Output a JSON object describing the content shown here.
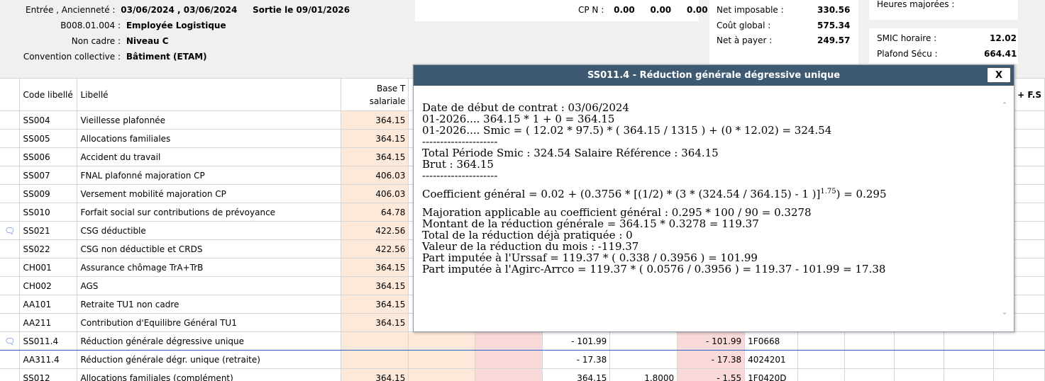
{
  "header": {
    "entry_label": "Entrée , Ancienneté :",
    "entry_value": "03/06/2024 , 03/06/2024",
    "exit_value": "Sortie le 09/01/2026",
    "job_code": "B008.01.004 :",
    "job_value": "Employée Logistique",
    "status_label": "Non cadre :",
    "status_value": "Niveau C",
    "convention_label": "Convention collective :",
    "convention_value": "Bâtiment (ETAM)",
    "cpn_label": "CP N :",
    "cpn_values": [
      "0.00",
      "0.00",
      "0.00"
    ],
    "net_imposable_label": "Net imposable :",
    "net_imposable": "330.56",
    "cout_global_label": "Coût global :",
    "cout_global": "575.34",
    "net_payer_label": "Net à payer :",
    "net_payer": "249.57",
    "heures_label": "Heures majorées :",
    "smic_label": "SMIC horaire :",
    "smic": "12.02",
    "plafond_label": "Plafond Sécu :",
    "plafond": "664.41"
  },
  "table": {
    "col_code": "Code libellé",
    "col_libelle": "Libellé",
    "col_base": "Base T salariale",
    "col_right": "+ F.S",
    "rows": [
      {
        "code": "SS004",
        "label": "Vieillesse plafonnée",
        "base": "364.15"
      },
      {
        "code": "SS005",
        "label": "Allocations familiales",
        "base": "364.15"
      },
      {
        "code": "SS006",
        "label": "Accident du travail",
        "base": "364.15"
      },
      {
        "code": "SS007",
        "label": "FNAL plafonné majoration CP",
        "base": "406.03"
      },
      {
        "code": "SS009",
        "label": "Versement mobilité majoration CP",
        "base": "406.03"
      },
      {
        "code": "SS010",
        "label": "Forfait social sur contributions de prévoyance",
        "base": "64.78"
      },
      {
        "code": "SS021",
        "label": "CSG déductible",
        "base": "422.56"
      },
      {
        "code": "SS022",
        "label": "CSG non déductible et CRDS",
        "base": "422.56"
      },
      {
        "code": "CH001",
        "label": "Assurance chômage TrA+TrB",
        "base": "364.15"
      },
      {
        "code": "CH002",
        "label": "AGS",
        "base": "364.15"
      },
      {
        "code": "AA101",
        "label": "Retraite TU1 non cadre",
        "base": "364.15"
      },
      {
        "code": "AA211",
        "label": "Contribution d'Equilibre Général TU1",
        "base": "364.15"
      }
    ],
    "row_ss011": {
      "code": "SS011.4",
      "label": "Réduction générale dégressive unique",
      "v1": "- 101.99",
      "v2": "- 101.99",
      "acct": "1F0668"
    },
    "row_aa311": {
      "code": "AA311.4",
      "label": "Réduction générale dégr. unique (retraite)",
      "v1": "- 17.38",
      "v2": "- 17.38",
      "acct": "4024201"
    },
    "row_partial": {
      "code": "SS012",
      "label": "Allocations familiales (complément)",
      "base": "364.15",
      "v1": "364.15",
      "v2": "1.8000",
      "v3": "- 1.55",
      "acct": "1F0420D"
    }
  },
  "popup": {
    "title": "SS011.4 - Réduction générale dégressive unique",
    "close_label": "X",
    "line1": "Date de début de contrat : 03/06/2024",
    "line2": "01-2026.... 364.15 * 1 + 0 = 364.15",
    "line3": "01-2026.... Smic = ( 12.02 * 97.5) * ( 364.15 / 1315 ) + (0 * 12.02) = 324.54",
    "sep1": "---------------------",
    "line4": "Total Période Smic : 324.54 Salaire Référence : 364.15",
    "line5": "Brut : 364.15",
    "sep2": "---------------------",
    "coef_pre": "Coefficient général = 0.02 + (0.3756 * [(1/2) * (3 * (324.54 / 364.15) - 1 )]",
    "coef_exp": "1.75",
    "coef_post": ") = 0.295",
    "line6": "Majoration applicable au coefficient général : 0.295 * 100 / 90 = 0.3278",
    "line7": "Montant de la réduction générale = 364.15 * 0.3278 = 119.37",
    "line8": "Total de la réduction déjà pratiquée : 0",
    "line9": "Valeur de la réduction du mois : -119.37",
    "line10": "Part imputée à l'Urssaf = 119.37 * ( 0.338 / 0.3956 ) = 101.99",
    "line11": "Part imputée à l'Agirc-Arrco = 119.37 * ( 0.0576 / 0.3956 ) = 119.37 - 101.99 = 17.38"
  }
}
